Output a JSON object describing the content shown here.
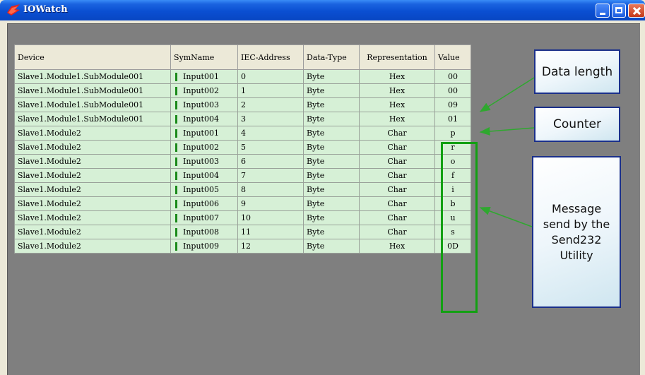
{
  "window": {
    "title": "IOWatch",
    "accent": "#0a4fd2"
  },
  "table": {
    "headers": [
      "Device",
      "SymName",
      "IEC-Address",
      "Data-Type",
      "Representation",
      "Value"
    ],
    "rows": [
      {
        "device": "Slave1.Module1.SubModule001",
        "symname": "Input001",
        "iec": "0",
        "datatype": "Byte",
        "rep": "Hex",
        "value": "00"
      },
      {
        "device": "Slave1.Module1.SubModule001",
        "symname": "Input002",
        "iec": "1",
        "datatype": "Byte",
        "rep": "Hex",
        "value": "00"
      },
      {
        "device": "Slave1.Module1.SubModule001",
        "symname": "Input003",
        "iec": "2",
        "datatype": "Byte",
        "rep": "Hex",
        "value": "09"
      },
      {
        "device": "Slave1.Module1.SubModule001",
        "symname": "Input004",
        "iec": "3",
        "datatype": "Byte",
        "rep": "Hex",
        "value": "01"
      },
      {
        "device": "Slave1.Module2",
        "symname": "Input001",
        "iec": "4",
        "datatype": "Byte",
        "rep": "Char",
        "value": "p"
      },
      {
        "device": "Slave1.Module2",
        "symname": "Input002",
        "iec": "5",
        "datatype": "Byte",
        "rep": "Char",
        "value": "r"
      },
      {
        "device": "Slave1.Module2",
        "symname": "Input003",
        "iec": "6",
        "datatype": "Byte",
        "rep": "Char",
        "value": "o"
      },
      {
        "device": "Slave1.Module2",
        "symname": "Input004",
        "iec": "7",
        "datatype": "Byte",
        "rep": "Char",
        "value": "f"
      },
      {
        "device": "Slave1.Module2",
        "symname": "Input005",
        "iec": "8",
        "datatype": "Byte",
        "rep": "Char",
        "value": "i"
      },
      {
        "device": "Slave1.Module2",
        "symname": "Input006",
        "iec": "9",
        "datatype": "Byte",
        "rep": "Char",
        "value": "b"
      },
      {
        "device": "Slave1.Module2",
        "symname": "Input007",
        "iec": "10",
        "datatype": "Byte",
        "rep": "Char",
        "value": "u"
      },
      {
        "device": "Slave1.Module2",
        "symname": "Input008",
        "iec": "11",
        "datatype": "Byte",
        "rep": "Char",
        "value": "s"
      },
      {
        "device": "Slave1.Module2",
        "symname": "Input009",
        "iec": "12",
        "datatype": "Byte",
        "rep": "Hex",
        "value": "0D"
      }
    ]
  },
  "callouts": {
    "data_length": "Data length",
    "counter": "Counter",
    "message": "Message send by the Send232 Utility"
  },
  "colors": {
    "row_bg": "#d6f0d6",
    "value_outline": "#12a012",
    "arrow": "#2fa82f",
    "callout_border": "#1a2f8a"
  }
}
